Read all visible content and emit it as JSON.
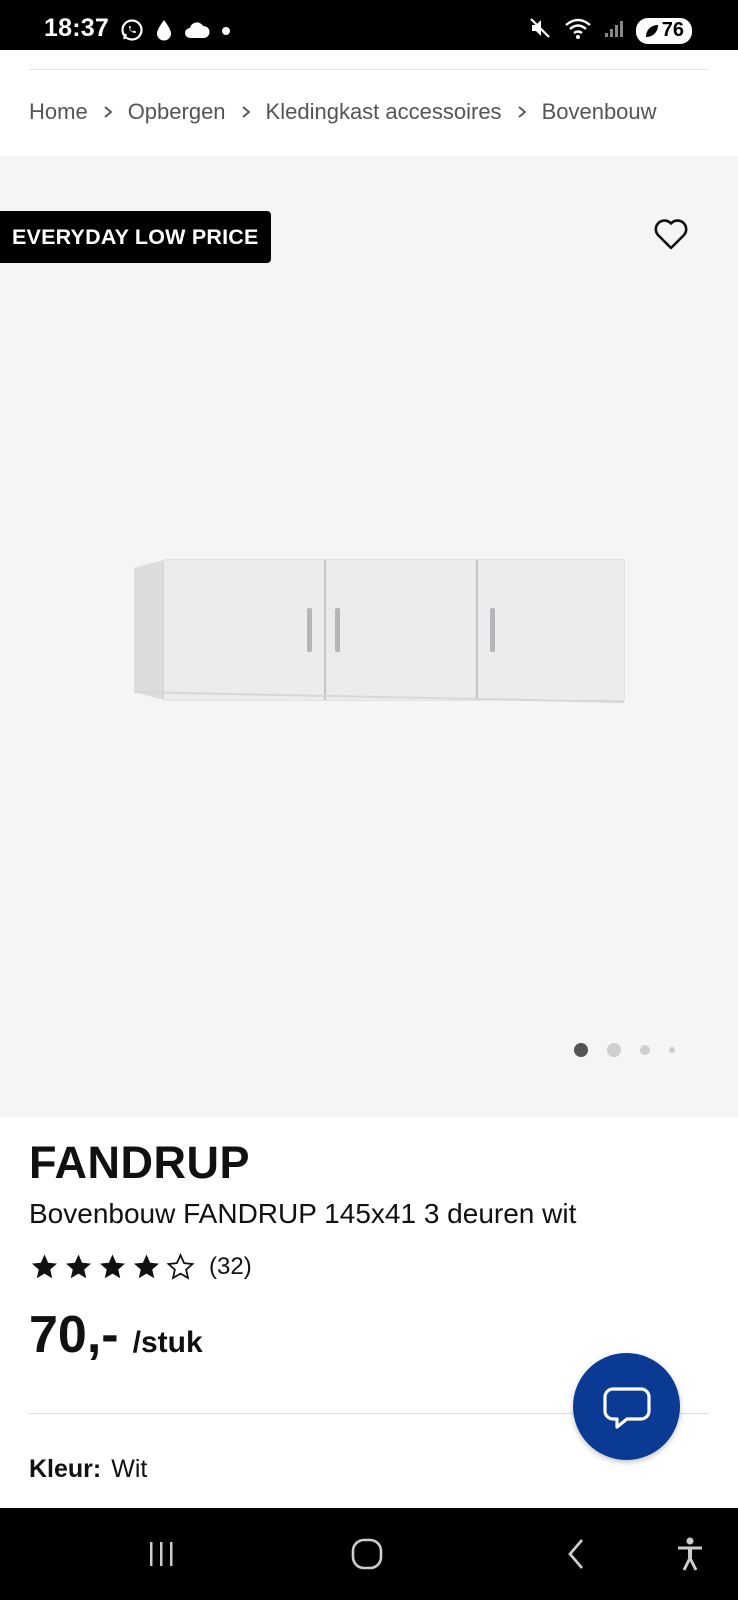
{
  "status_bar": {
    "time": "18:37",
    "battery": "76",
    "left_icons": [
      "whatsapp-icon",
      "water-drop-icon",
      "cloud-icon",
      "dot-icon"
    ],
    "right_icons": [
      "mute-icon",
      "wifi-icon",
      "signal-icon",
      "battery-icon"
    ]
  },
  "breadcrumb": [
    "Home",
    "Opbergen",
    "Kledingkast accessoires",
    "Bovenbouw"
  ],
  "gallery": {
    "badge": "EVERYDAY LOW PRICE",
    "image_count": 4,
    "active_image": 1
  },
  "product": {
    "name": "FANDRUP",
    "description": "Bovenbouw FANDRUP 145x41 3 deuren wit",
    "rating": 4,
    "rating_max": 5,
    "review_count": "(32)",
    "price": "70,-",
    "price_unit": "/stuk",
    "color_label": "Kleur:",
    "color_value": "Wit"
  },
  "colors": {
    "chat_button": "#0a3a93",
    "badge_background": "#000000",
    "gallery_background": "#f5f5f5"
  },
  "nav_bar": [
    "recent-apps-icon",
    "home-icon",
    "back-icon",
    "accessibility-icon"
  ]
}
